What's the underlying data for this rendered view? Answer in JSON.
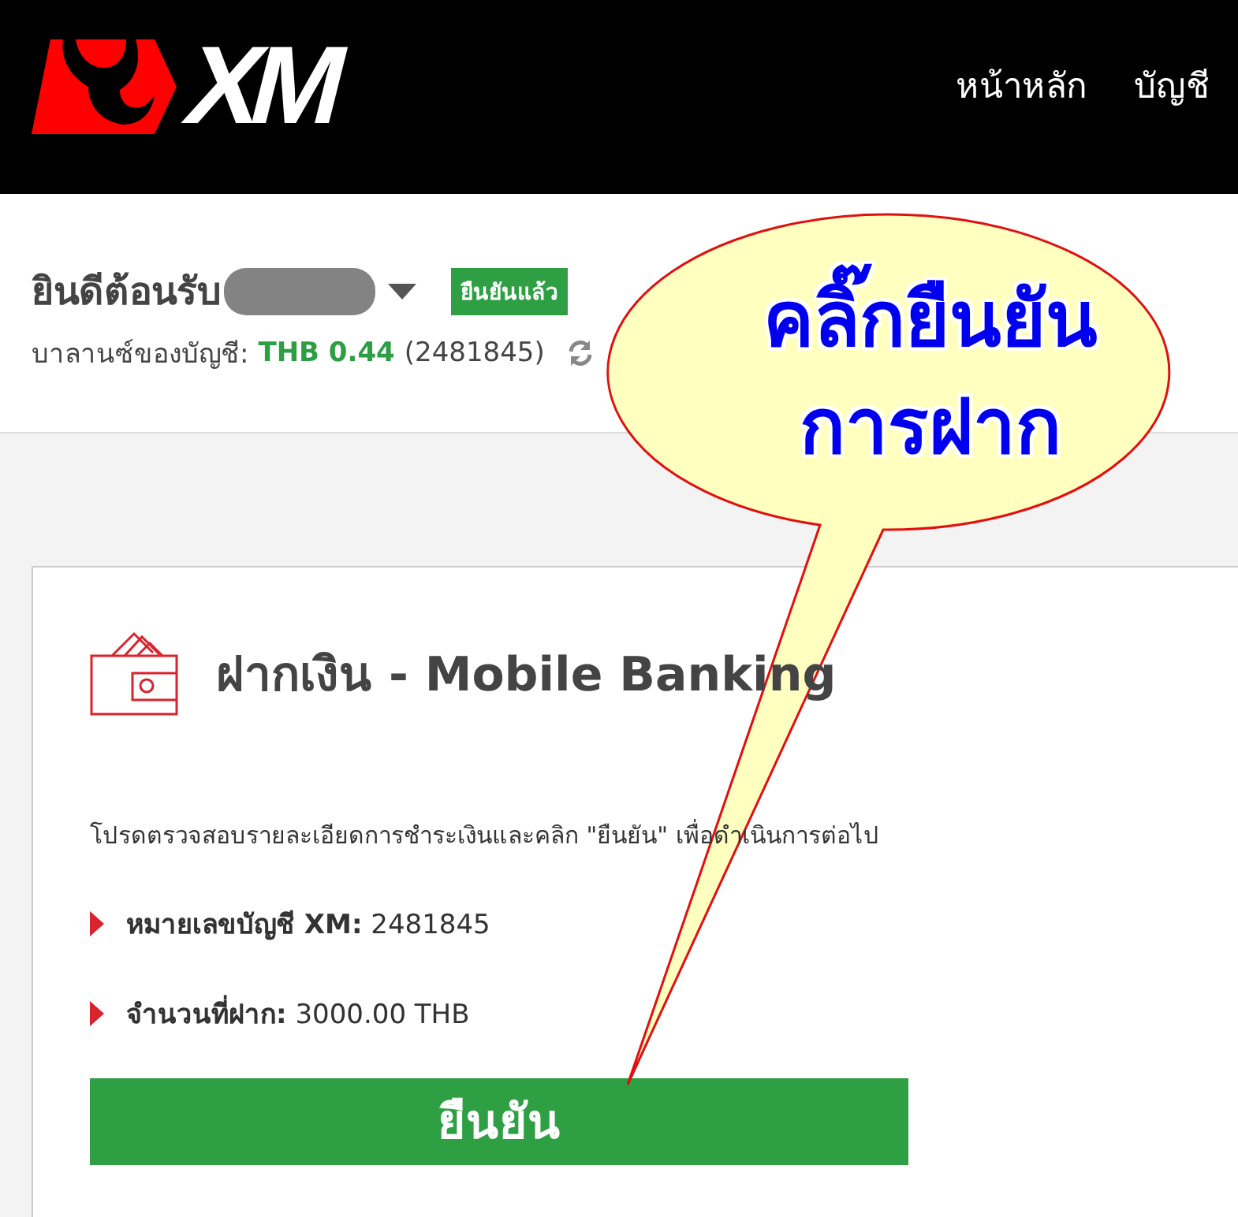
{
  "header": {
    "logo_text": "XM",
    "nav": [
      "หน้าหลัก",
      "บัญชี"
    ]
  },
  "account": {
    "welcome": "ยินดีต้อนรับ",
    "verified_badge": "ยืนยันแล้ว",
    "balance_label": "บาลานซ์ของบัญชี:",
    "balance_value": "THB 0.44",
    "account_number": "(2481845)"
  },
  "deposit": {
    "title": "ฝากเงิน - Mobile Banking",
    "instruction": "โปรดตรวจสอบรายละเอียดการชำระเงินและคลิก \"ยืนยัน\" เพื่อดำเนินการต่อไป",
    "details": [
      {
        "label": "หมายเลขบัญชี XM:",
        "value": "2481845"
      },
      {
        "label": "จำนวนที่ฝาก:",
        "value": "3000.00 THB"
      }
    ],
    "confirm_button": "ยืนยัน"
  },
  "callout": {
    "lines": [
      "คลิ๊กยืนยัน",
      "การฝาก"
    ]
  }
}
